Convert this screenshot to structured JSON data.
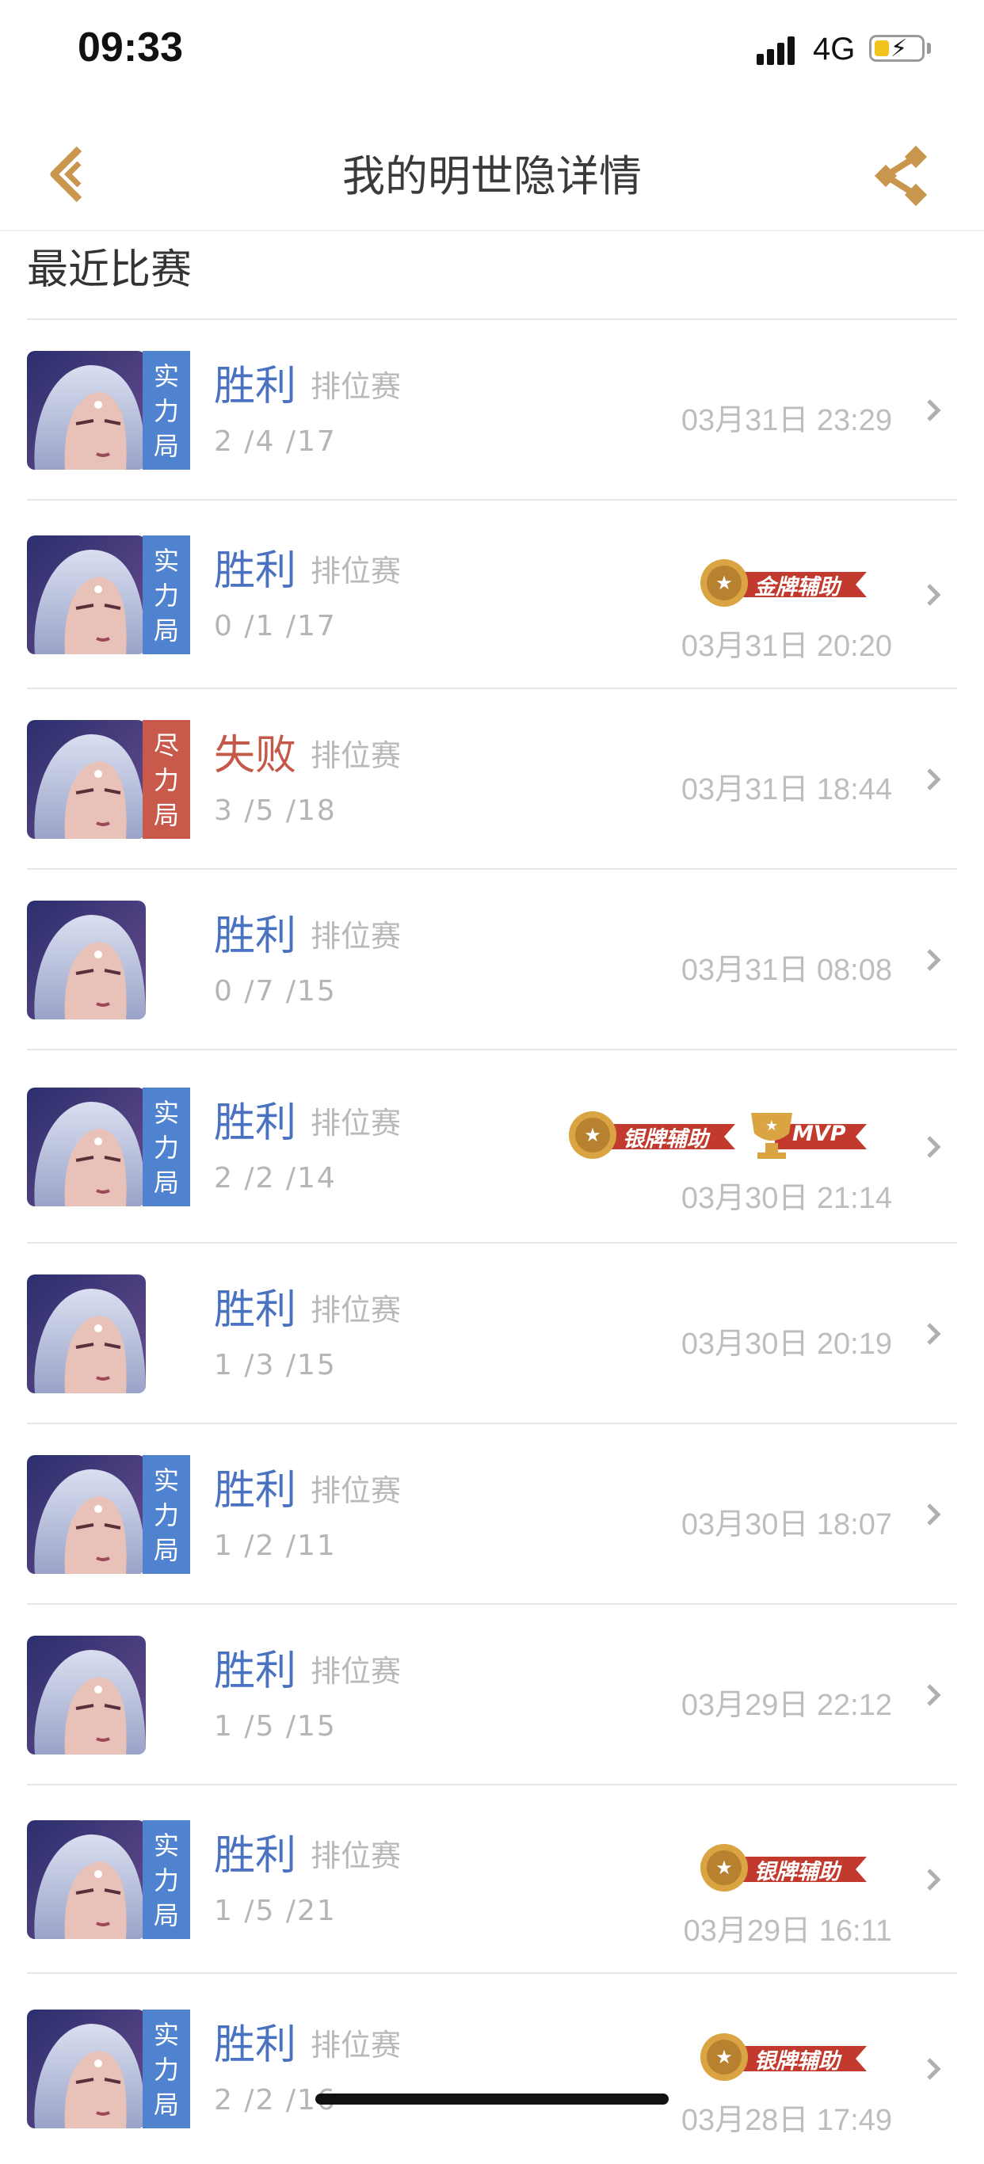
{
  "status_bar": {
    "time": "09:33",
    "network": "4G"
  },
  "nav": {
    "title": "我的明世隐详情"
  },
  "section": {
    "title": "最近比赛"
  },
  "matches": [
    {
      "badge": "实力局",
      "badge_color": "#4f82cf",
      "result": "胜利",
      "result_type": "win",
      "mode": "排位赛",
      "kda": "2 /4 /17",
      "date": "03月31日 23:29",
      "medals": []
    },
    {
      "badge": "实力局",
      "badge_color": "#4f82cf",
      "result": "胜利",
      "result_type": "win",
      "mode": "排位赛",
      "kda": "0 /1 /17",
      "date": "03月31日 20:20",
      "medals": [
        "金牌辅助"
      ]
    },
    {
      "badge": "尽力局",
      "badge_color": "#c9594a",
      "result": "失败",
      "result_type": "lose",
      "mode": "排位赛",
      "kda": "3 /5 /18",
      "date": "03月31日 18:44",
      "medals": []
    },
    {
      "badge": "",
      "badge_color": "",
      "result": "胜利",
      "result_type": "win",
      "mode": "排位赛",
      "kda": "0 /7 /15",
      "date": "03月31日 08:08",
      "medals": []
    },
    {
      "badge": "实力局",
      "badge_color": "#4f82cf",
      "result": "胜利",
      "result_type": "win",
      "mode": "排位赛",
      "kda": "2 /2 /14",
      "date": "03月30日 21:14",
      "medals": [
        "银牌辅助",
        "MVP"
      ]
    },
    {
      "badge": "",
      "badge_color": "",
      "result": "胜利",
      "result_type": "win",
      "mode": "排位赛",
      "kda": "1 /3 /15",
      "date": "03月30日 20:19",
      "medals": []
    },
    {
      "badge": "实力局",
      "badge_color": "#4f82cf",
      "result": "胜利",
      "result_type": "win",
      "mode": "排位赛",
      "kda": "1 /2 /11",
      "date": "03月30日 18:07",
      "medals": []
    },
    {
      "badge": "",
      "badge_color": "",
      "result": "胜利",
      "result_type": "win",
      "mode": "排位赛",
      "kda": "1 /5 /15",
      "date": "03月29日 22:12",
      "medals": []
    },
    {
      "badge": "实力局",
      "badge_color": "#4f82cf",
      "result": "胜利",
      "result_type": "win",
      "mode": "排位赛",
      "kda": "1 /5 /21",
      "date": "03月29日 16:11",
      "medals": [
        "银牌辅助"
      ]
    },
    {
      "badge": "实力局",
      "badge_color": "#4f82cf",
      "result": "胜利",
      "result_type": "win",
      "mode": "排位赛",
      "kda": "2 /2 /16",
      "date": "03月28日 17:49",
      "medals": [
        "银牌辅助"
      ]
    }
  ],
  "colors": {
    "accent": "#c9964e",
    "win": "#4a72c0",
    "lose": "#c45849",
    "medal_red": "#c23a2e",
    "gold": "#d9a441"
  }
}
